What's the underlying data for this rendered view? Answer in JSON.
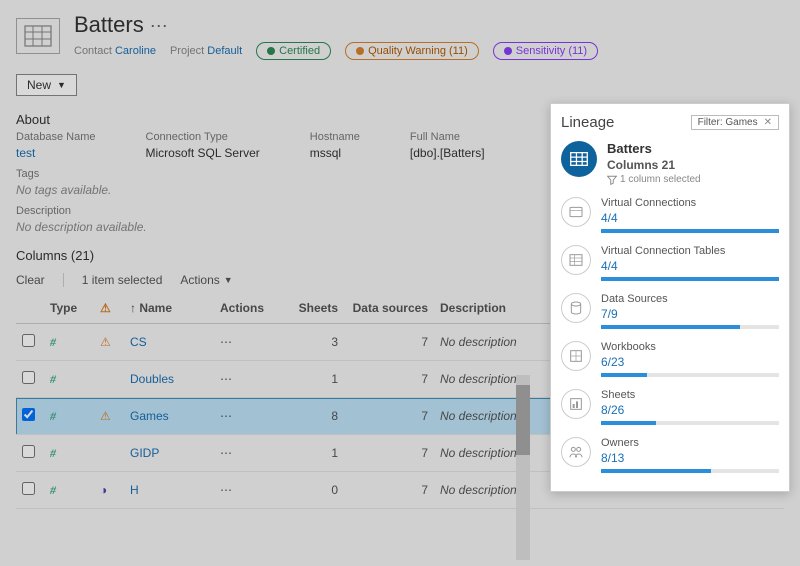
{
  "header": {
    "title": "Batters",
    "contact_label": "Contact",
    "contact": "Caroline",
    "project_label": "Project",
    "project": "Default",
    "badge_certified": "Certified",
    "badge_warning": "Quality Warning (11)",
    "badge_sensitivity": "Sensitivity (11)",
    "new_button": "New"
  },
  "about": {
    "heading": "About",
    "db_label": "Database Name",
    "db_value": "test",
    "conn_label": "Connection Type",
    "conn_value": "Microsoft SQL Server",
    "host_label": "Hostname",
    "host_value": "mssql",
    "fullname_label": "Full Name",
    "fullname_value": "[dbo].[Batters]",
    "tags_label": "Tags",
    "tags_value": "No tags available.",
    "desc_label": "Description",
    "desc_value": "No description available."
  },
  "columns": {
    "heading": "Columns (21)",
    "clear": "Clear",
    "selected_text": "1 item selected",
    "actions": "Actions",
    "th_type": "Type",
    "th_name": "↑ Name",
    "th_actions": "Actions",
    "th_sheets": "Sheets",
    "th_datasources": "Data sources",
    "th_desc": "Description",
    "rows": [
      {
        "name": "CS",
        "sheets": "3",
        "ds": "7",
        "desc": "No description",
        "warn": true,
        "sens": false,
        "checked": false
      },
      {
        "name": "Doubles",
        "sheets": "1",
        "ds": "7",
        "desc": "No description",
        "warn": false,
        "sens": false,
        "checked": false
      },
      {
        "name": "Games",
        "sheets": "8",
        "ds": "7",
        "desc": "No description",
        "warn": true,
        "sens": false,
        "checked": true
      },
      {
        "name": "GIDP",
        "sheets": "1",
        "ds": "7",
        "desc": "No description",
        "warn": false,
        "sens": false,
        "checked": false
      },
      {
        "name": "H",
        "sheets": "0",
        "ds": "7",
        "desc": "No description",
        "warn": false,
        "sens": true,
        "checked": false
      }
    ]
  },
  "lineage": {
    "title": "Lineage",
    "filter_label": "Filter: Games",
    "root_title": "Batters",
    "root_sub": "Columns 21",
    "root_sel": "1 column selected",
    "items": [
      {
        "name": "Virtual Connections",
        "ratio": "4/4",
        "pct": 100
      },
      {
        "name": "Virtual Connection Tables",
        "ratio": "4/4",
        "pct": 100
      },
      {
        "name": "Data Sources",
        "ratio": "7/9",
        "pct": 78
      },
      {
        "name": "Workbooks",
        "ratio": "6/23",
        "pct": 26
      },
      {
        "name": "Sheets",
        "ratio": "8/26",
        "pct": 31
      },
      {
        "name": "Owners",
        "ratio": "8/13",
        "pct": 62
      }
    ]
  }
}
